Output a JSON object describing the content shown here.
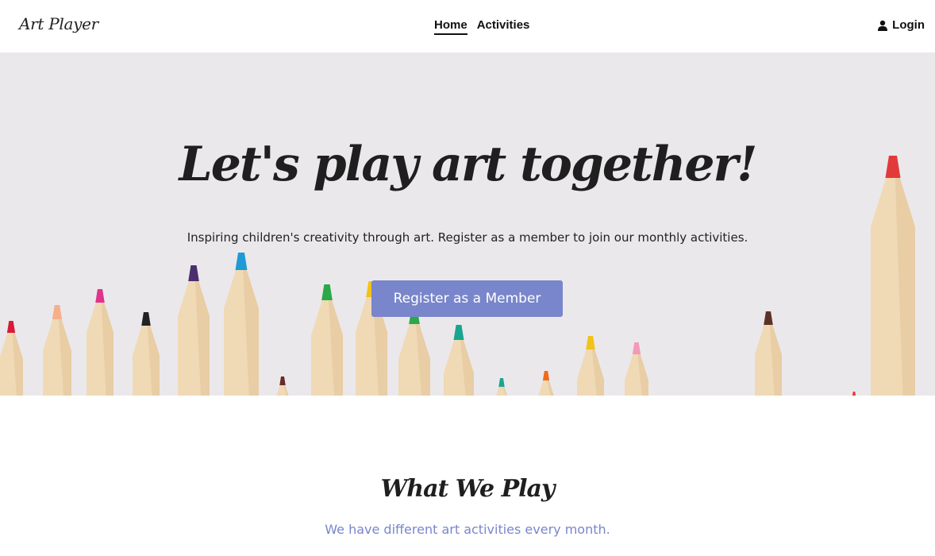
{
  "header": {
    "brand": "Art Player",
    "nav": [
      {
        "label": "Home",
        "active": true
      },
      {
        "label": "Activities",
        "active": false
      }
    ],
    "login_label": "Login",
    "login_icon": "user-icon"
  },
  "hero": {
    "title": "Let's play art together!",
    "subtitle": "Inspiring children's creativity through art. Register as a member to join our monthly activities.",
    "cta_label": "Register as a Member",
    "image": "colored-pencils-image"
  },
  "section": {
    "title": "What We Play",
    "subtitle": "We have different art activities every month."
  },
  "colors": {
    "accent": "#7986cb",
    "text": "#1f1f1f",
    "hero_bg": "#ebe8ec",
    "wood": "#f0d9b5"
  }
}
